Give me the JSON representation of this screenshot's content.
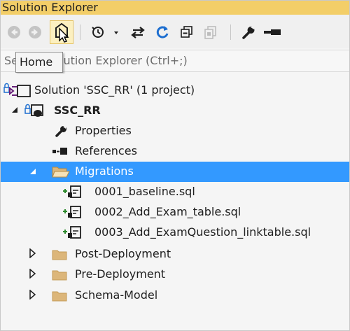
{
  "panel": {
    "title": "Solution Explorer"
  },
  "search": {
    "placeholder": "Search Solution Explorer (Ctrl+;)"
  },
  "tooltip": {
    "text": "Home"
  },
  "tree": {
    "solution": "Solution 'SSC_RR' (1 project)",
    "project": "SSC_RR",
    "properties": "Properties",
    "references": "References",
    "migrations": "Migrations",
    "files": [
      "0001_baseline.sql",
      "0002_Add_Exam_table.sql",
      "0003_Add_ExamQuestion_linktable.sql"
    ],
    "post_deployment": "Post-Deployment",
    "pre_deployment": "Pre-Deployment",
    "schema_model": "Schema-Model"
  },
  "icons": {
    "back": "back-arrow-icon",
    "forward": "forward-arrow-icon",
    "home": "home-icon",
    "pending_changes": "clock-filter-icon",
    "sync": "sync-with-document-icon",
    "refresh": "refresh-icon",
    "collapse_all": "collapse-all-icon",
    "show_all_files": "show-all-files-icon",
    "properties": "wrench-icon",
    "preview": "preview-icon"
  },
  "colors": {
    "title_bar": "#f3ce68",
    "selection": "#3399ff",
    "folder": "#dcb67a",
    "add_glyph": "#2e8b2e"
  }
}
